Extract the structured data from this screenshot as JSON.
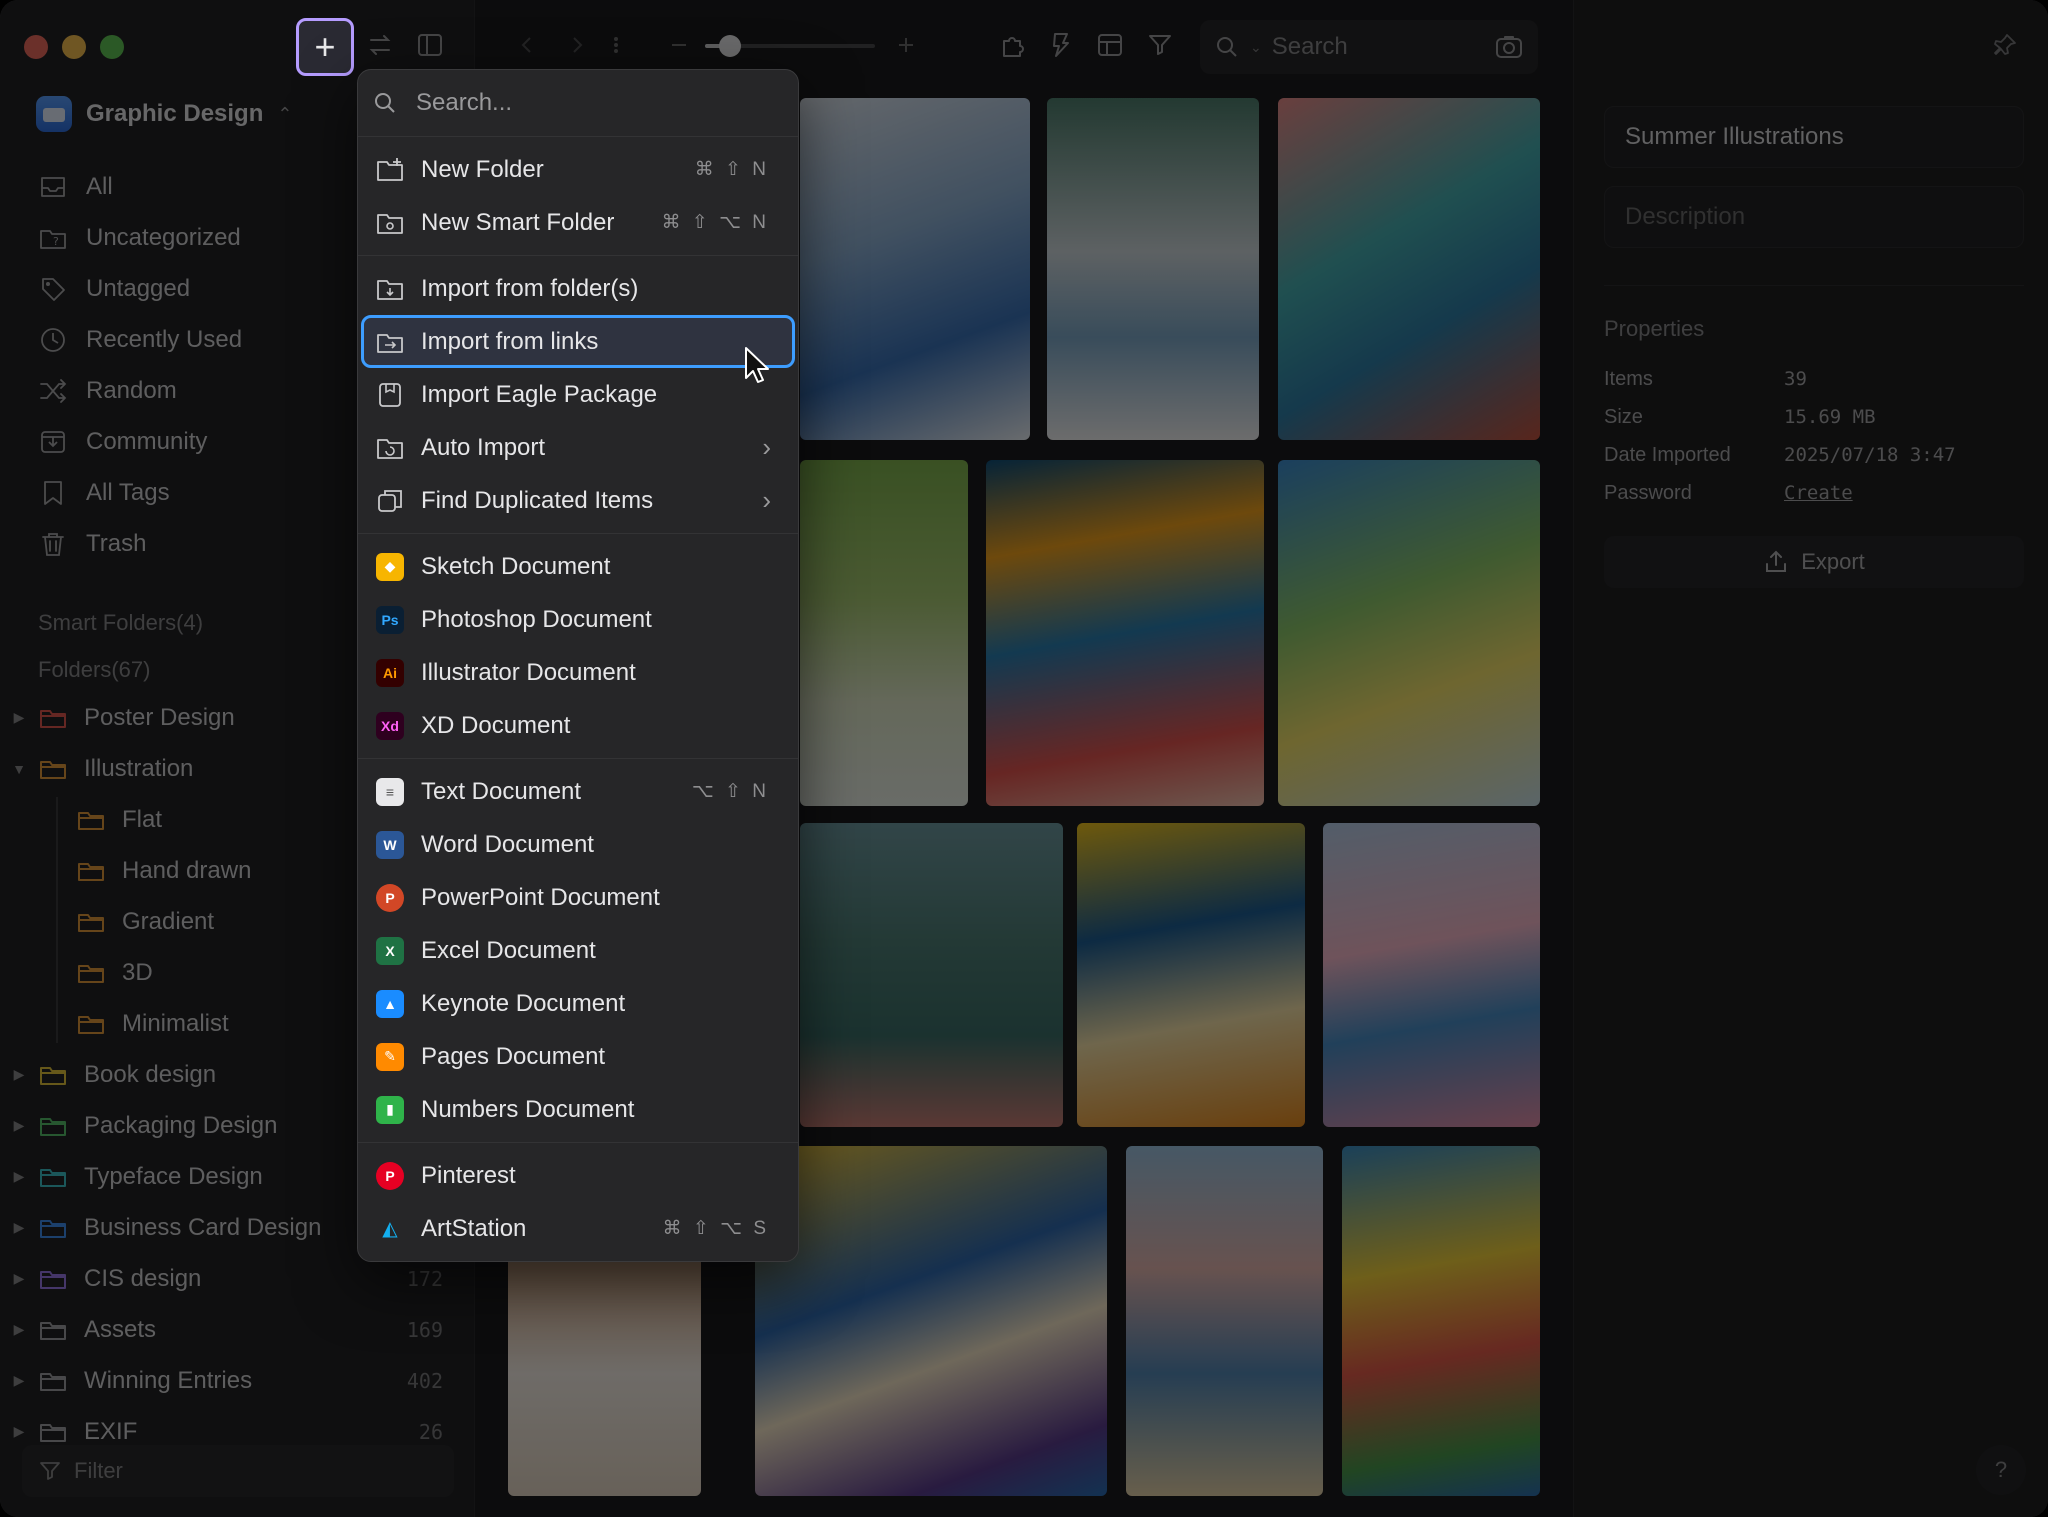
{
  "library": {
    "name": "Graphic Design"
  },
  "nav": [
    {
      "label": "All",
      "icon": "inbox-icon"
    },
    {
      "label": "Uncategorized",
      "icon": "folder-question-icon"
    },
    {
      "label": "Untagged",
      "icon": "tag-icon"
    },
    {
      "label": "Recently Used",
      "icon": "clock-icon"
    },
    {
      "label": "Random",
      "icon": "shuffle-icon"
    },
    {
      "label": "Community",
      "icon": "download-box-icon"
    },
    {
      "label": "All Tags",
      "icon": "bookmark-icon"
    },
    {
      "label": "Trash",
      "icon": "trash-icon"
    }
  ],
  "sections": {
    "smart_folders": "Smart Folders(4)",
    "folders": "Folders(67)"
  },
  "folders": [
    {
      "label": "Poster Design",
      "color": "#e0584f",
      "count": "",
      "child": false,
      "expanded": false
    },
    {
      "label": "Illustration",
      "color": "#e39a3a",
      "count": "",
      "child": false,
      "expanded": true
    },
    {
      "label": "Flat",
      "color": "#e39a3a",
      "count": "",
      "child": true
    },
    {
      "label": "Hand drawn",
      "color": "#e39a3a",
      "count": "",
      "child": true
    },
    {
      "label": "Gradient",
      "color": "#e39a3a",
      "count": "",
      "child": true
    },
    {
      "label": "3D",
      "color": "#e39a3a",
      "count": "",
      "child": true
    },
    {
      "label": "Minimalist",
      "color": "#e39a3a",
      "count": "",
      "child": true
    },
    {
      "label": "Book design",
      "color": "#e3c33a",
      "count": "",
      "child": false,
      "expanded": false
    },
    {
      "label": "Packaging Design",
      "color": "#57c26a",
      "count": "",
      "child": false,
      "expanded": false
    },
    {
      "label": "Typeface Design",
      "color": "#3cc0c8",
      "count": "",
      "child": false,
      "expanded": false
    },
    {
      "label": "Business Card Design",
      "color": "#3f8ff0",
      "count": "",
      "child": false,
      "expanded": false
    },
    {
      "label": "CIS design",
      "color": "#9a78e8",
      "count": "172",
      "child": false,
      "expanded": false
    },
    {
      "label": "Assets",
      "color": "#a0a0a4",
      "count": "169",
      "child": false,
      "expanded": false
    },
    {
      "label": "Winning Entries",
      "color": "#a0a0a4",
      "count": "402",
      "child": false,
      "expanded": false
    },
    {
      "label": "EXIF",
      "color": "#a0a0a4",
      "count": "26",
      "child": false,
      "expanded": false
    }
  ],
  "filter": {
    "placeholder": "Filter"
  },
  "toolbar": {
    "search_placeholder": "Search",
    "add_symbol": "+"
  },
  "menu": {
    "search_placeholder": "Search...",
    "groups": [
      [
        {
          "label": "New Folder",
          "icon": "new-folder-icon",
          "shortcut": "⌘ ⇧ N"
        },
        {
          "label": "New Smart Folder",
          "icon": "smart-folder-icon",
          "shortcut": "⌘ ⇧ ⌥ N"
        }
      ],
      [
        {
          "label": "Import from folder(s)",
          "icon": "folder-import-icon",
          "shortcut": ""
        },
        {
          "label": "Import from links",
          "icon": "link-import-icon",
          "shortcut": "",
          "active": true
        },
        {
          "label": "Import Eagle Package",
          "icon": "package-icon",
          "shortcut": ""
        },
        {
          "label": "Auto Import",
          "icon": "auto-import-icon",
          "shortcut": "",
          "submenu": true
        },
        {
          "label": "Find Duplicated Items",
          "icon": "duplicate-icon",
          "shortcut": "",
          "submenu": true
        }
      ],
      [
        {
          "label": "Sketch Document",
          "icon": "sketch-icon",
          "app": "sketch"
        },
        {
          "label": "Photoshop Document",
          "icon": "photoshop-icon",
          "app": "ps"
        },
        {
          "label": "Illustrator Document",
          "icon": "illustrator-icon",
          "app": "ai"
        },
        {
          "label": "XD Document",
          "icon": "xd-icon",
          "app": "xd"
        }
      ],
      [
        {
          "label": "Text Document",
          "icon": "text-document-icon",
          "app": "txt",
          "shortcut": "⌥ ⇧ N"
        },
        {
          "label": "Word Document",
          "icon": "word-icon",
          "app": "word"
        },
        {
          "label": "PowerPoint Document",
          "icon": "powerpoint-icon",
          "app": "ppt"
        },
        {
          "label": "Excel Document",
          "icon": "excel-icon",
          "app": "excel"
        },
        {
          "label": "Keynote Document",
          "icon": "keynote-icon",
          "app": "keynote"
        },
        {
          "label": "Pages Document",
          "icon": "pages-icon",
          "app": "pages"
        },
        {
          "label": "Numbers Document",
          "icon": "numbers-icon",
          "app": "numbers"
        }
      ],
      [
        {
          "label": "Pinterest",
          "icon": "pinterest-icon",
          "app": "pinterest"
        },
        {
          "label": "ArtStation",
          "icon": "artstation-icon",
          "app": "artstation",
          "shortcut": "⌘ ⇧ ⌥ S"
        }
      ]
    ]
  },
  "inspector": {
    "title": "Summer Illustrations",
    "description_placeholder": "Description",
    "properties_label": "Properties",
    "properties": [
      {
        "key": "Items",
        "value": "39"
      },
      {
        "key": "Size",
        "value": "15.69 MB"
      },
      {
        "key": "Date Imported",
        "value": "2025/07/18 3:47"
      },
      {
        "key": "Password",
        "value": "Create",
        "link": true
      }
    ],
    "export_label": "Export",
    "help_label": "?"
  },
  "colors": {
    "accent_blue": "#3d9dff",
    "add_border": "#b59cff"
  }
}
